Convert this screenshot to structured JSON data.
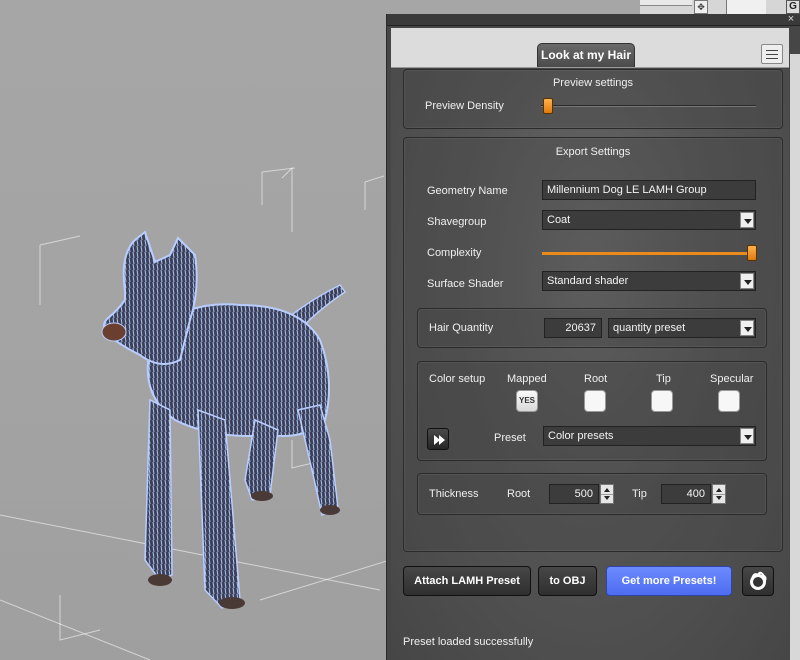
{
  "panel": {
    "tab_label": "Look at my Hair",
    "close_glyph": "×",
    "menu_icon": "list-menu-icon"
  },
  "viewport": {
    "corner_label": "G",
    "nav_glyph": "✥"
  },
  "preview": {
    "title": "Preview settings",
    "density_label": "Preview Density",
    "density_fraction": 0.02
  },
  "export": {
    "title": "Export Settings",
    "geometry_label": "Geometry Name",
    "geometry_value": "Millennium Dog LE LAMH Group",
    "shavegroup_label": "Shavegroup",
    "shavegroup_value": "Coat",
    "complexity_label": "Complexity",
    "complexity_fraction": 1.0,
    "shader_label": "Surface Shader",
    "shader_value": "Standard shader"
  },
  "hair": {
    "label": "Hair Quantity",
    "value": "20637",
    "preset_value": "quantity preset"
  },
  "color": {
    "label": "Color setup",
    "columns": [
      "Mapped",
      "Root",
      "Tip",
      "Specular"
    ],
    "mapped_value": "YES",
    "preset_label": "Preset",
    "preset_value": "Color presets"
  },
  "thickness": {
    "label": "Thickness",
    "root_label": "Root",
    "root_value": "500",
    "tip_label": "Tip",
    "tip_value": "400"
  },
  "buttons": {
    "attach": "Attach LAMH Preset",
    "to_obj": "to OBJ",
    "get_more": "Get more Presets!"
  },
  "status": "Preset loaded successfully",
  "colors": {
    "accent_orange": "#e88b1c",
    "button_blue": "#5a78f8",
    "panel_bg": "#464646"
  }
}
